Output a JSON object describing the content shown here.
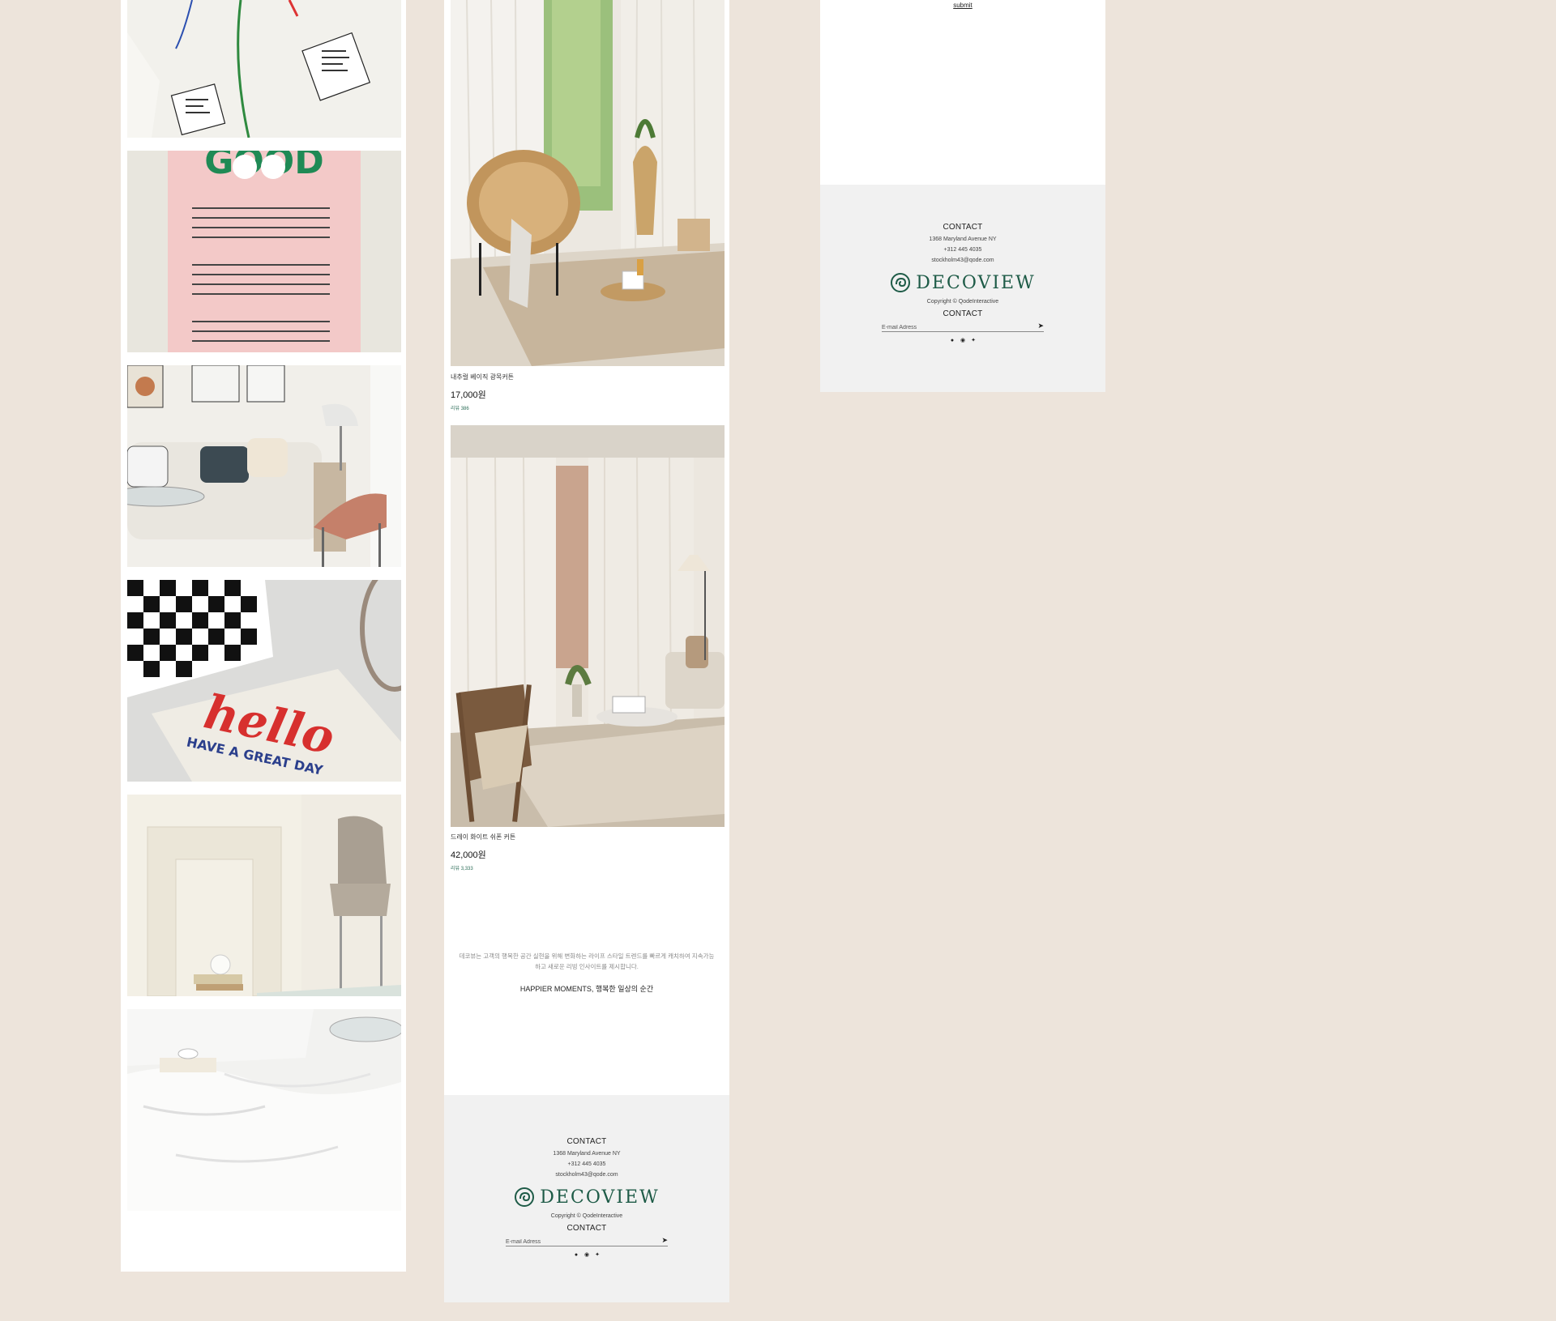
{
  "left_column": {
    "tiles": [
      {
        "subject": "white cloth with printed labels"
      },
      {
        "subject": "pink calendar tapestry",
        "text": "GOOD"
      },
      {
        "subject": "living room with white sofa and orange chair"
      },
      {
        "subject": "hello doormat with checkered cushion",
        "text_line1": "hello",
        "text_line2": "HAVE A GREAT DAY"
      },
      {
        "subject": "beige chair beside white fireplace"
      },
      {
        "subject": "white bedding with side table"
      }
    ]
  },
  "middle_column": {
    "products": [
      {
        "name": "내추럴 베이직 광목커튼",
        "price": "17,000원",
        "reviews": "리뷰 386"
      },
      {
        "name": "드레이 화이트 쉬폰 커튼",
        "price": "42,000원",
        "reviews": "리뷰 3,333"
      }
    ],
    "about": {
      "text": "데코뷰는 고객의 행복한 공간 실현을 위해 변화하는 라이프 스타일 트렌드를 빠르게 캐치하여 지속가능하고 새로운 리빙 인사이트를 제시합니다.",
      "title": "HAPPIER MOMENTS, 행복한 일상의 순간"
    }
  },
  "right_column": {
    "submit_label": "submit"
  },
  "footer": {
    "contact_title": "CONTACT",
    "address": "1368 Maryland Avenue NY",
    "phone": "+312 445 4035",
    "email": "stockholm43@qode.com",
    "logo_text": "DECOVIEW",
    "copyright": "Copyright © QodeInteractive",
    "newsletter_title": "CONTACT",
    "email_placeholder": "E-mail Adress",
    "send_icon": "paper-plane-icon",
    "social": [
      "facebook-icon",
      "instagram-icon",
      "twitter-icon"
    ]
  },
  "colors": {
    "background": "#ede4db",
    "panel": "#ffffff",
    "footer_bg": "#f1f1f1",
    "brand": "#1e5b47",
    "review_green": "#2f6f5a"
  }
}
